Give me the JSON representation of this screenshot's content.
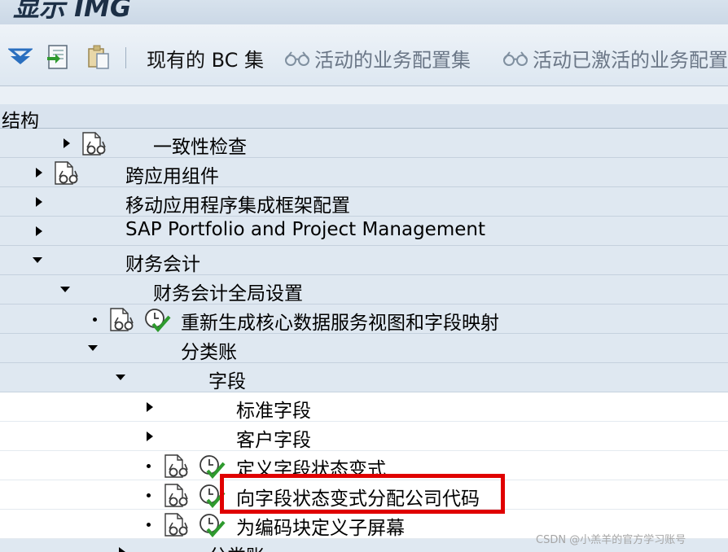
{
  "window": {
    "title": "显示 IMG"
  },
  "toolbar": {
    "btn_existing_bc": "现有的 BC 集",
    "btn_active_bc": "活动的业务配置集",
    "btn_activated_bc": "活动已激活的业务配置"
  },
  "tree": {
    "header": "结构",
    "items": [
      {
        "label": "一致性检查"
      },
      {
        "label": "跨应用组件"
      },
      {
        "label": "移动应用程序集成框架配置"
      },
      {
        "label": "SAP Portfolio and Project Management"
      },
      {
        "label": "财务会计"
      },
      {
        "label": "财务会计全局设置"
      },
      {
        "label": "重新生成核心数据服务视图和字段映射"
      },
      {
        "label": "分类账"
      },
      {
        "label": "字段"
      },
      {
        "label": "标准字段"
      },
      {
        "label": "客户字段"
      },
      {
        "label": "定义字段状态变式"
      },
      {
        "label": "向字段状态变式分配公司代码"
      },
      {
        "label": "为编码块定义子屏幕"
      },
      {
        "label": "分类账"
      }
    ]
  },
  "watermark": "CSDN @小羔羊的官方学习账号",
  "colors": {
    "highlight": "#e00000",
    "row_blue": "#dfe8f1",
    "header": "#d9e3ee"
  }
}
